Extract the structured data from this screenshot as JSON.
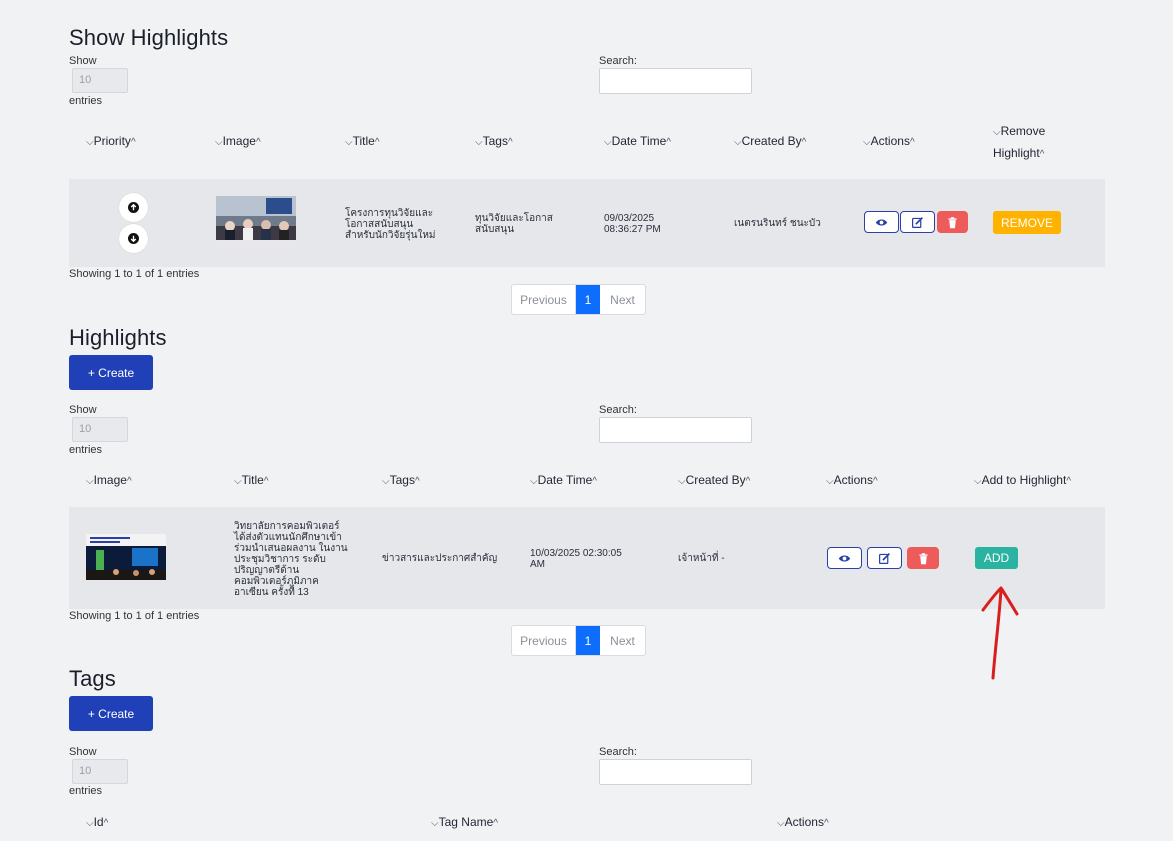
{
  "show_highlights": {
    "title": "Show Highlights",
    "length_label_top": "Show",
    "length_value": "10",
    "length_label_bottom": "entries",
    "search_label": "Search:",
    "columns": [
      "Priority",
      "Image",
      "Title",
      "Tags",
      "Date Time",
      "Created By",
      "Actions",
      "Remove",
      "Highlight"
    ],
    "row": {
      "title": "โครงการทุนวิจัยและ\nโอกาสสนับสนุน\nสำหรับนักวิจัยรุ่นใหม่",
      "tags": "ทุนวิจัยและโอกาส\nสนับสนุน",
      "datetime": "09/03/2025\n08:36:27 PM",
      "created_by": "เนตรนรินทร์ ชนะบัว",
      "remove_label": "REMOVE"
    },
    "info": "Showing 1 to 1 of 1 entries",
    "pager": {
      "prev": "Previous",
      "page": "1",
      "next": "Next"
    }
  },
  "highlights": {
    "title": "Highlights",
    "create_label": "+ Create",
    "length_label_top": "Show",
    "length_value": "10",
    "length_label_bottom": "entries",
    "search_label": "Search:",
    "columns": [
      "Image",
      "Title",
      "Tags",
      "Date Time",
      "Created By",
      "Actions",
      "Add to Highlight"
    ],
    "row": {
      "title": "วิทยาลัยการคอมพิวเตอร์\nได้ส่งตัวแทนนักศึกษาเข้า\nร่วมนำเสนอผลงาน ในงาน\nประชุมวิชาการ ระดับ\nปริญญาตรีด้าน\nคอมพิวเตอร์ภูมิภาค\nอาเซียน ครั้งที่ 13",
      "tags": "ข่าวสารและประกาศสำคัญ",
      "datetime": "10/03/2025 02:30:05\nAM",
      "created_by": "เจ้าหน้าที่ -",
      "add_label": "ADD"
    },
    "info": "Showing 1 to 1 of 1 entries",
    "pager": {
      "prev": "Previous",
      "page": "1",
      "next": "Next"
    }
  },
  "tags": {
    "title": "Tags",
    "create_label": "+ Create",
    "length_label_top": "Show",
    "length_value": "10",
    "length_label_bottom": "entries",
    "search_label": "Search:",
    "columns": [
      "Id",
      "Tag Name",
      "Actions"
    ]
  },
  "colors": {
    "primary": "#2040b7",
    "remove": "#ffb300",
    "add": "#2ab3a0",
    "delete": "#ee5b5b",
    "page_active": "#0d6efd",
    "annotation": "#d81f1f"
  },
  "icons": [
    "arrow-up-icon",
    "arrow-down-icon",
    "eye-icon",
    "edit-icon",
    "trash-icon"
  ]
}
